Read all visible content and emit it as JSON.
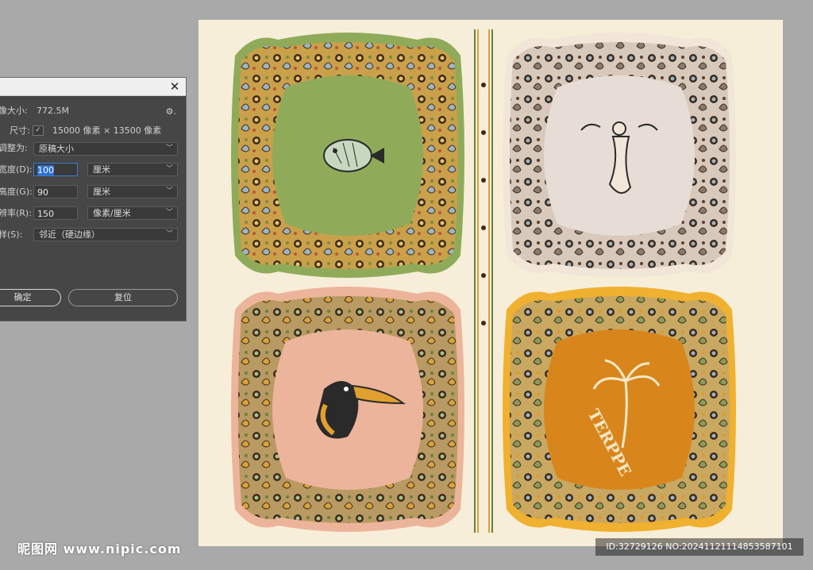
{
  "dialog": {
    "close_glyph": "✕",
    "image_size_label": "像大小:",
    "image_size_value": "772.5M",
    "dimensions_label": "尺寸:",
    "dimensions_value": "15000 像素 × 13500 像素",
    "fit_to_label": "调整为:",
    "fit_to_value": "原稿大小",
    "width_label": "宽度(D):",
    "width_value": "100",
    "width_unit": "厘米",
    "height_label": "高度(G):",
    "height_value": "90",
    "height_unit": "厘米",
    "resolution_label": "辨率(R):",
    "resolution_value": "150",
    "resolution_unit": "像素/厘米",
    "resample_label": "样(S):",
    "resample_value": "邻近（硬边缘）",
    "ok_label": "确定",
    "reset_label": "复位",
    "gear_glyph": "⚙."
  },
  "artwork": {
    "scarf_text": "TERPPE",
    "colors": {
      "canvas": "#f7eed9",
      "green": "#8fab5a",
      "white": "#e7ddd6",
      "pink": "#ecb49a",
      "orange": "#d8861c",
      "paisley_dark": "#3b2a1c",
      "paisley_gold": "#d9a23a",
      "paisley_blue": "#9eb4c0"
    }
  },
  "watermark": {
    "left_text": "昵图网 www.nipic.com",
    "right_text": "ID:32729126 NO:20241121114853587101"
  }
}
